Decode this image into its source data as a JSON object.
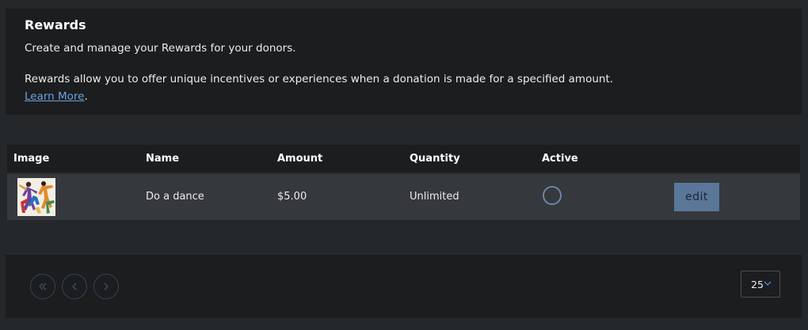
{
  "header": {
    "title": "Rewards",
    "subtitle": "Create and manage your Rewards for your donors.",
    "description": "Rewards allow you to offer unique incentives or experiences when a donation is made for a specified amount.",
    "learn_more": "Learn More",
    "learn_more_suffix": "."
  },
  "table": {
    "columns": [
      "Image",
      "Name",
      "Amount",
      "Quantity",
      "Active"
    ],
    "rows": [
      {
        "image": "dancers-thumbnail",
        "name": "Do a dance",
        "amount": "$5.00",
        "quantity": "Unlimited",
        "active": false,
        "edit_label": "edit"
      }
    ]
  },
  "pagination": {
    "first_icon": "double-chevron-left-icon",
    "prev_icon": "chevron-left-icon",
    "next_icon": "chevron-right-icon",
    "page_size": "25",
    "page_size_icon": "chevron-down-icon"
  },
  "colors": {
    "background": "#25282b",
    "panel": "#1c1d1f",
    "row": "#35383c",
    "link": "#6aa3df",
    "button": "#5a7799",
    "radio_border": "#6b86aa"
  }
}
